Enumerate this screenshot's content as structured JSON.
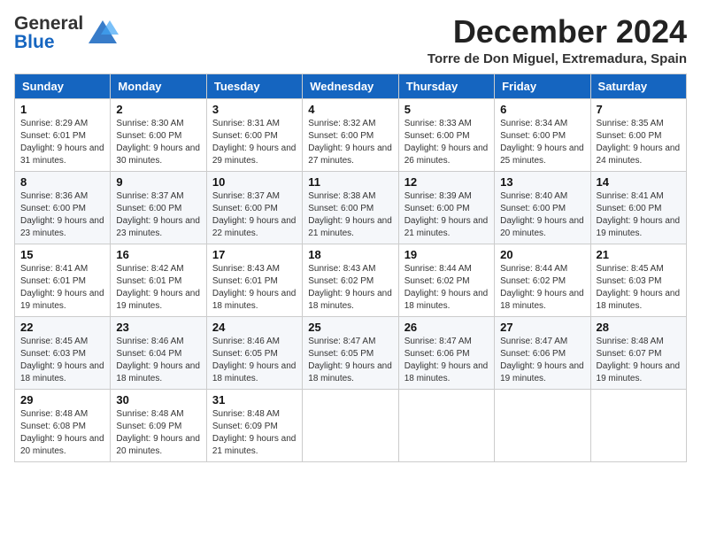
{
  "logo": {
    "line1": "General",
    "line2": "Blue"
  },
  "header": {
    "month": "December 2024",
    "location": "Torre de Don Miguel, Extremadura, Spain"
  },
  "weekdays": [
    "Sunday",
    "Monday",
    "Tuesday",
    "Wednesday",
    "Thursday",
    "Friday",
    "Saturday"
  ],
  "weeks": [
    [
      {
        "day": "1",
        "text": "Sunrise: 8:29 AM\nSunset: 6:01 PM\nDaylight: 9 hours and 31 minutes."
      },
      {
        "day": "2",
        "text": "Sunrise: 8:30 AM\nSunset: 6:00 PM\nDaylight: 9 hours and 30 minutes."
      },
      {
        "day": "3",
        "text": "Sunrise: 8:31 AM\nSunset: 6:00 PM\nDaylight: 9 hours and 29 minutes."
      },
      {
        "day": "4",
        "text": "Sunrise: 8:32 AM\nSunset: 6:00 PM\nDaylight: 9 hours and 27 minutes."
      },
      {
        "day": "5",
        "text": "Sunrise: 8:33 AM\nSunset: 6:00 PM\nDaylight: 9 hours and 26 minutes."
      },
      {
        "day": "6",
        "text": "Sunrise: 8:34 AM\nSunset: 6:00 PM\nDaylight: 9 hours and 25 minutes."
      },
      {
        "day": "7",
        "text": "Sunrise: 8:35 AM\nSunset: 6:00 PM\nDaylight: 9 hours and 24 minutes."
      }
    ],
    [
      {
        "day": "8",
        "text": "Sunrise: 8:36 AM\nSunset: 6:00 PM\nDaylight: 9 hours and 23 minutes."
      },
      {
        "day": "9",
        "text": "Sunrise: 8:37 AM\nSunset: 6:00 PM\nDaylight: 9 hours and 23 minutes."
      },
      {
        "day": "10",
        "text": "Sunrise: 8:37 AM\nSunset: 6:00 PM\nDaylight: 9 hours and 22 minutes."
      },
      {
        "day": "11",
        "text": "Sunrise: 8:38 AM\nSunset: 6:00 PM\nDaylight: 9 hours and 21 minutes."
      },
      {
        "day": "12",
        "text": "Sunrise: 8:39 AM\nSunset: 6:00 PM\nDaylight: 9 hours and 21 minutes."
      },
      {
        "day": "13",
        "text": "Sunrise: 8:40 AM\nSunset: 6:00 PM\nDaylight: 9 hours and 20 minutes."
      },
      {
        "day": "14",
        "text": "Sunrise: 8:41 AM\nSunset: 6:00 PM\nDaylight: 9 hours and 19 minutes."
      }
    ],
    [
      {
        "day": "15",
        "text": "Sunrise: 8:41 AM\nSunset: 6:01 PM\nDaylight: 9 hours and 19 minutes."
      },
      {
        "day": "16",
        "text": "Sunrise: 8:42 AM\nSunset: 6:01 PM\nDaylight: 9 hours and 19 minutes."
      },
      {
        "day": "17",
        "text": "Sunrise: 8:43 AM\nSunset: 6:01 PM\nDaylight: 9 hours and 18 minutes."
      },
      {
        "day": "18",
        "text": "Sunrise: 8:43 AM\nSunset: 6:02 PM\nDaylight: 9 hours and 18 minutes."
      },
      {
        "day": "19",
        "text": "Sunrise: 8:44 AM\nSunset: 6:02 PM\nDaylight: 9 hours and 18 minutes."
      },
      {
        "day": "20",
        "text": "Sunrise: 8:44 AM\nSunset: 6:02 PM\nDaylight: 9 hours and 18 minutes."
      },
      {
        "day": "21",
        "text": "Sunrise: 8:45 AM\nSunset: 6:03 PM\nDaylight: 9 hours and 18 minutes."
      }
    ],
    [
      {
        "day": "22",
        "text": "Sunrise: 8:45 AM\nSunset: 6:03 PM\nDaylight: 9 hours and 18 minutes."
      },
      {
        "day": "23",
        "text": "Sunrise: 8:46 AM\nSunset: 6:04 PM\nDaylight: 9 hours and 18 minutes."
      },
      {
        "day": "24",
        "text": "Sunrise: 8:46 AM\nSunset: 6:05 PM\nDaylight: 9 hours and 18 minutes."
      },
      {
        "day": "25",
        "text": "Sunrise: 8:47 AM\nSunset: 6:05 PM\nDaylight: 9 hours and 18 minutes."
      },
      {
        "day": "26",
        "text": "Sunrise: 8:47 AM\nSunset: 6:06 PM\nDaylight: 9 hours and 18 minutes."
      },
      {
        "day": "27",
        "text": "Sunrise: 8:47 AM\nSunset: 6:06 PM\nDaylight: 9 hours and 19 minutes."
      },
      {
        "day": "28",
        "text": "Sunrise: 8:48 AM\nSunset: 6:07 PM\nDaylight: 9 hours and 19 minutes."
      }
    ],
    [
      {
        "day": "29",
        "text": "Sunrise: 8:48 AM\nSunset: 6:08 PM\nDaylight: 9 hours and 20 minutes."
      },
      {
        "day": "30",
        "text": "Sunrise: 8:48 AM\nSunset: 6:09 PM\nDaylight: 9 hours and 20 minutes."
      },
      {
        "day": "31",
        "text": "Sunrise: 8:48 AM\nSunset: 6:09 PM\nDaylight: 9 hours and 21 minutes."
      },
      null,
      null,
      null,
      null
    ]
  ]
}
